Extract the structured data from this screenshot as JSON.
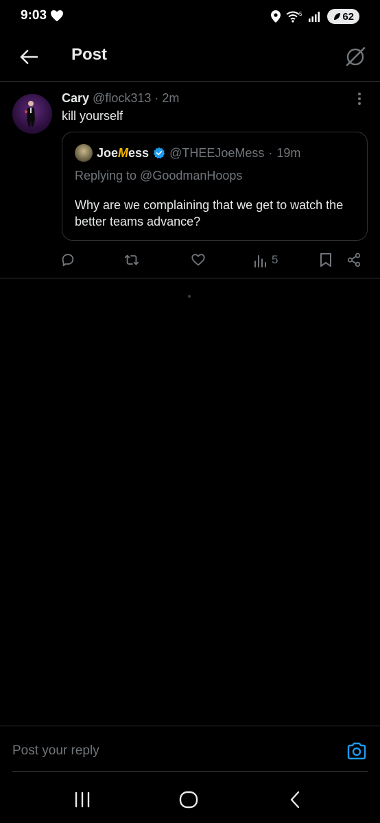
{
  "status": {
    "time": "9:03",
    "battery": "62",
    "signal": "5"
  },
  "header": {
    "title": "Post"
  },
  "post": {
    "author_name": "Cary",
    "author_handle": "@flock313",
    "separator": "·",
    "time": "2m",
    "text": "kill yourself",
    "quote": {
      "name_prefix": "Joe",
      "name_accent": "M",
      "name_suffix": "ess",
      "handle": "@THEEJoeMess",
      "separator": "·",
      "time": "19m",
      "replying_to": "Replying to @GoodmanHoops",
      "text": "Why are we complaining that we get to watch the better teams advance?"
    },
    "actions": {
      "views": "5"
    }
  },
  "reply": {
    "placeholder": "Post your reply"
  },
  "colors": {
    "accent": "#1d9bf0",
    "muted": "#71767b",
    "background": "#000000",
    "text": "#e7e9ea"
  },
  "icons": [
    "heart-icon",
    "location-icon",
    "wifi-icon",
    "signal-icon",
    "battery-icon",
    "back-arrow-icon",
    "grok-icon",
    "more-icon",
    "verified-icon",
    "reply-icon",
    "repost-icon",
    "like-icon",
    "views-icon",
    "bookmark-icon",
    "share-icon",
    "camera-icon",
    "recent-apps-icon",
    "home-icon",
    "nav-back-icon"
  ]
}
